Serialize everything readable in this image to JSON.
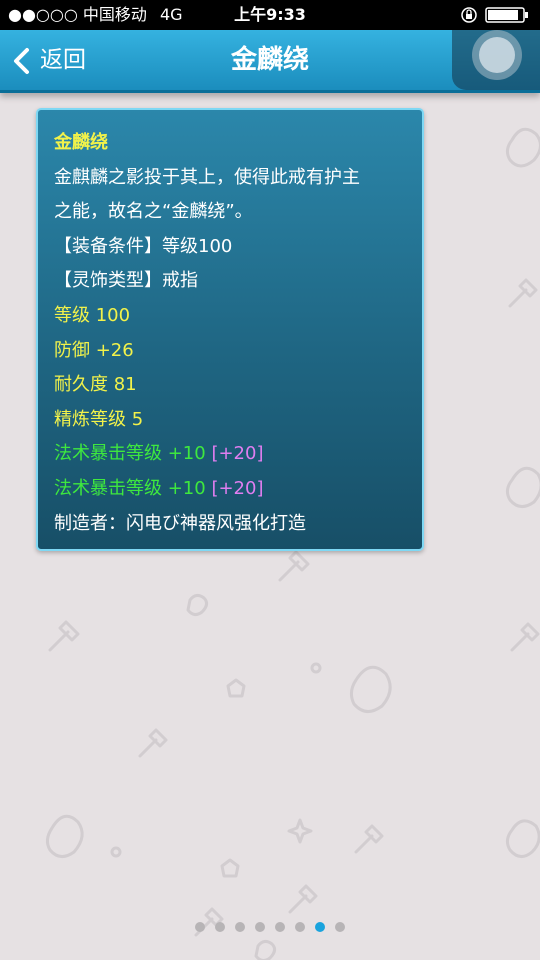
{
  "status_bar": {
    "carrier": "●●○○○ 中国移动",
    "network": "4G",
    "time": "上午9:33"
  },
  "nav": {
    "back_label": "返回",
    "title": "金麟绕"
  },
  "item": {
    "name": "金麟绕",
    "description": [
      "金麒麟之影投于其上，使得此戒有护主",
      "之能，故名之“金麟绕”。"
    ],
    "requirement": "【装备条件】等级100",
    "type": "【灵饰类型】戒指",
    "level": "等级 100",
    "defense": "防御 +26",
    "durability": "耐久度 81",
    "refine": "精炼等级 5",
    "bonus_stats": [
      {
        "text": "法术暴击等级 +10",
        "extra": "[+20]"
      },
      {
        "text": "法术暴击等级 +10",
        "extra": "[+20]"
      }
    ],
    "maker": "制造者：闪电び神器风强化打造"
  },
  "colors": {
    "highlight_yellow": "#f2f24a",
    "bonus_green": "#3ee83e",
    "extra_purple": "#e07ef0",
    "nav_blue": "#1b8dbd",
    "active_dot": "#1aa3dd"
  },
  "pager": {
    "total": 8,
    "active_index": 6
  }
}
